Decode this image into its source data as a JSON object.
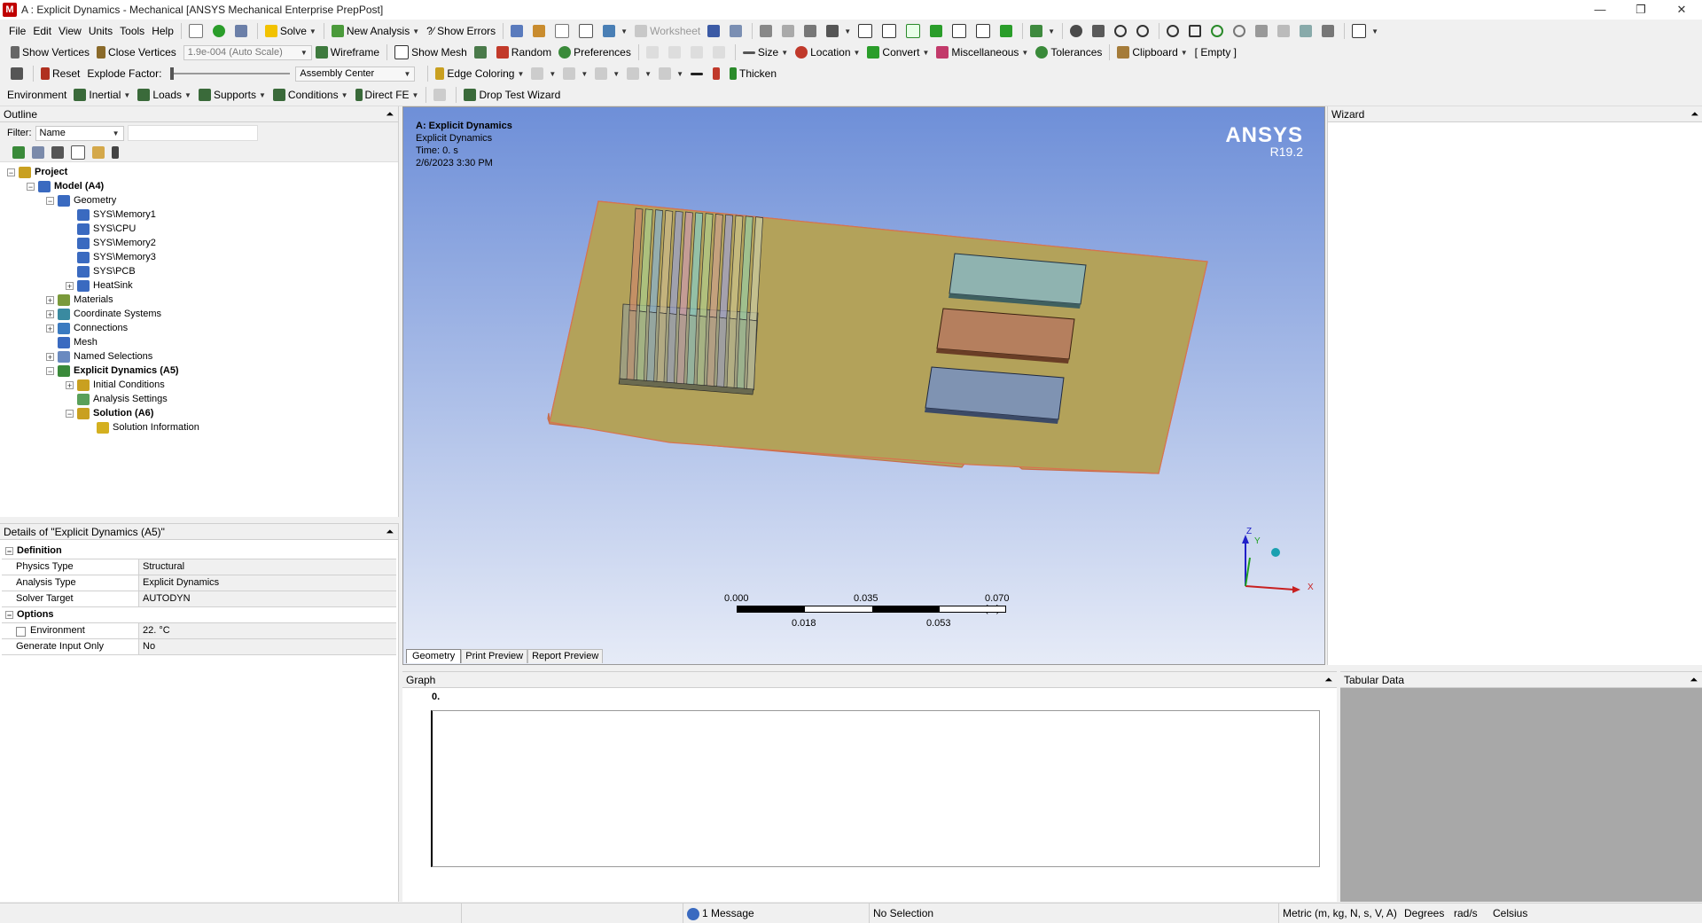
{
  "window": {
    "title": "A : Explicit Dynamics - Mechanical [ANSYS Mechanical Enterprise PrepPost]",
    "app_icon": "M"
  },
  "menu": [
    "File",
    "Edit",
    "View",
    "Units",
    "Tools",
    "Help"
  ],
  "toolbar1": {
    "solve": "Solve",
    "new_analysis": "New Analysis",
    "show_errors": "?⁄ Show Errors",
    "worksheet": "Worksheet"
  },
  "toolbar2": {
    "show_vertices": "Show Vertices",
    "close_vertices": "Close Vertices",
    "scale": "1.9e-004 (Auto Scale)",
    "wireframe": "Wireframe",
    "show_mesh": "Show Mesh",
    "random": "Random",
    "preferences": "Preferences",
    "size": "Size",
    "location": "Location",
    "convert": "Convert",
    "miscellaneous": "Miscellaneous",
    "tolerances": "Tolerances",
    "clipboard": "Clipboard",
    "clipboard_value": "[ Empty ]"
  },
  "toolbar3": {
    "reset": "Reset",
    "explode_factor": "Explode Factor:",
    "assembly_center": "Assembly Center",
    "edge_coloring": "Edge Coloring",
    "thicken": "Thicken"
  },
  "toolbar4": {
    "environment": "Environment",
    "inertial": "Inertial",
    "loads": "Loads",
    "supports": "Supports",
    "conditions": "Conditions",
    "direct_fe": "Direct FE",
    "drop_test": "Drop Test Wizard"
  },
  "outline": {
    "title": "Outline",
    "filter_label": "Filter:",
    "filter_value": "Name",
    "items": [
      {
        "label": "Project",
        "level": 0,
        "bold": true
      },
      {
        "label": "Model (A4)",
        "level": 1,
        "bold": true
      },
      {
        "label": "Geometry",
        "level": 2
      },
      {
        "label": "SYS\\Memory1",
        "level": 3
      },
      {
        "label": "SYS\\CPU",
        "level": 3
      },
      {
        "label": "SYS\\Memory2",
        "level": 3
      },
      {
        "label": "SYS\\Memory3",
        "level": 3
      },
      {
        "label": "SYS\\PCB",
        "level": 3
      },
      {
        "label": "HeatSink",
        "level": 3
      },
      {
        "label": "Materials",
        "level": 2
      },
      {
        "label": "Coordinate Systems",
        "level": 2
      },
      {
        "label": "Connections",
        "level": 2
      },
      {
        "label": "Mesh",
        "level": 2
      },
      {
        "label": "Named Selections",
        "level": 2
      },
      {
        "label": "Explicit Dynamics (A5)",
        "level": 2,
        "bold": true
      },
      {
        "label": "Initial Conditions",
        "level": 3
      },
      {
        "label": "Analysis Settings",
        "level": 3
      },
      {
        "label": "Solution (A6)",
        "level": 3,
        "bold": true
      },
      {
        "label": "Solution Information",
        "level": 4
      }
    ]
  },
  "details": {
    "title": "Details of \"Explicit Dynamics (A5)\"",
    "sections": [
      {
        "name": "Definition",
        "rows": [
          {
            "k": "Physics Type",
            "v": "Structural"
          },
          {
            "k": "Analysis Type",
            "v": "Explicit Dynamics"
          },
          {
            "k": "Solver Target",
            "v": "AUTODYN"
          }
        ]
      },
      {
        "name": "Options",
        "rows": [
          {
            "k": "Environment Temperature",
            "v": "22. °C"
          },
          {
            "k": "Generate Input Only",
            "v": "No"
          }
        ]
      }
    ]
  },
  "viewport": {
    "header_title": "A: Explicit Dynamics",
    "header_sub": "Explicit Dynamics",
    "header_time": "Time: 0. s",
    "header_date": "2/6/2023 3:30 PM",
    "brand": "ANSYS",
    "version": "R19.2",
    "scale_top": [
      "0.000",
      "0.035",
      "0.070 (m)"
    ],
    "scale_bottom": [
      "0.018",
      "0.053"
    ],
    "axis_z": "Z",
    "axis_y": "Y",
    "axis_x": "X",
    "tabs": [
      "Geometry",
      "Print Preview",
      "Report Preview"
    ],
    "colors": {
      "bg_top": "#6e8fd8",
      "bg_bottom": "#e6ebf7",
      "pcb": "#b3a25a",
      "mem1": "#8fb3b0",
      "cpu": "#b57f5e",
      "mem3": "#7f93b2"
    }
  },
  "wizard": {
    "title": "Wizard"
  },
  "graph": {
    "title": "Graph",
    "y_label": "0."
  },
  "tabular": {
    "title": "Tabular Data"
  },
  "status": {
    "messages": "1 Message",
    "selection": "No Selection",
    "units": "Metric (m, kg, N, s, V, A)",
    "angle": "Degrees",
    "rate": "rad/s",
    "temp": "Celsius"
  }
}
